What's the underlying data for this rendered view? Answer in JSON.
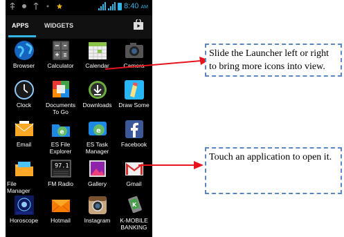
{
  "status_bar": {
    "time": "8:40",
    "ampm": "AM",
    "notification_icons": [
      "usb-icon",
      "usb-debug-icon",
      "usb-icon",
      "notification-dot-icon",
      "star-icon"
    ]
  },
  "tabs": {
    "apps": "APPS",
    "widgets": "WIDGETS"
  },
  "apps": [
    {
      "label": "Browser",
      "icon": "globe-icon"
    },
    {
      "label": "Calculator",
      "icon": "calculator-icon"
    },
    {
      "label": "Calendar",
      "icon": "calendar-icon"
    },
    {
      "label": "Camera",
      "icon": "camera-icon"
    },
    {
      "label": "Clock",
      "icon": "clock-icon"
    },
    {
      "label": "Documents To Go",
      "line1": "Documents",
      "line2": "To Go",
      "icon": "documents-icon"
    },
    {
      "label": "Downloads",
      "icon": "download-icon"
    },
    {
      "label": "Draw Some",
      "icon": "draw-icon"
    },
    {
      "label": "Email",
      "icon": "envelope-icon"
    },
    {
      "label": "ES File Explorer",
      "line1": "ES File",
      "line2": "Explorer",
      "icon": "es-file-icon"
    },
    {
      "label": "ES Task Manager",
      "line1": "ES Task",
      "line2": "Manager",
      "icon": "es-task-icon"
    },
    {
      "label": "Facebook",
      "icon": "facebook-icon"
    },
    {
      "label": "File Manager",
      "line1": "File",
      "line2": "Manager",
      "icon": "folder-icon"
    },
    {
      "label": "FM Radio",
      "icon": "radio-icon",
      "display": "97.1"
    },
    {
      "label": "Gallery",
      "icon": "gallery-icon"
    },
    {
      "label": "Gmail",
      "icon": "gmail-icon"
    },
    {
      "label": "Horoscope",
      "icon": "horoscope-icon"
    },
    {
      "label": "Hotmail",
      "icon": "hotmail-icon"
    },
    {
      "label": "Instagram",
      "icon": "instagram-icon"
    },
    {
      "label": "K-MOBILE BANKING",
      "line1": "K-MOBILE",
      "line2": "BANKING",
      "icon": "kbank-icon"
    }
  ],
  "callouts": {
    "slide": "Slide the Launcher left or right to bring more icons into view.",
    "touch": "Touch an application to open it."
  },
  "colors": {
    "accent": "#33b5e5",
    "arrow": "#e8141b",
    "callout_border": "#5a86c4"
  }
}
